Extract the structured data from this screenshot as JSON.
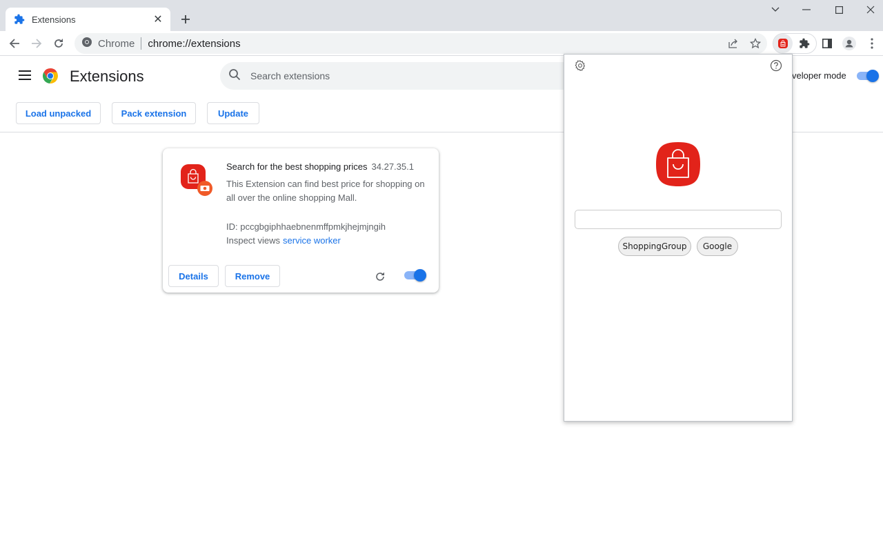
{
  "browser": {
    "tab": {
      "title": "Extensions",
      "icon": "puzzle-icon"
    },
    "omnibox": {
      "site_label": "Chrome",
      "url": "chrome://extensions"
    },
    "window_controls": [
      "tab-search",
      "minimize",
      "maximize",
      "close"
    ]
  },
  "header": {
    "title": "Extensions",
    "search_placeholder": "Search extensions",
    "developer_mode_label": "Developer mode",
    "developer_mode_visible_label": "veloper mode",
    "developer_mode_on": true
  },
  "actions": {
    "load_unpacked": "Load unpacked",
    "pack_extension": "Pack extension",
    "update": "Update"
  },
  "extension": {
    "name": "Search for the best shopping prices",
    "version": "34.27.35.1",
    "description": "This Extension can find best price for shopping on all over the online shopping Mall.",
    "id_label": "ID: pccgbgiphhaebnenmffpmkjhejmjngih",
    "inspect_label": "Inspect views",
    "inspect_link": "service worker",
    "details_label": "Details",
    "remove_label": "Remove",
    "enabled": true
  },
  "popup": {
    "search_value": "",
    "chips": [
      "ShoppingGroup",
      "Google"
    ],
    "brand_color": "#e2231a"
  },
  "colors": {
    "accent": "#1a73e8",
    "toggle_track": "#8ab4f8",
    "titlebar": "#dee1e6"
  }
}
